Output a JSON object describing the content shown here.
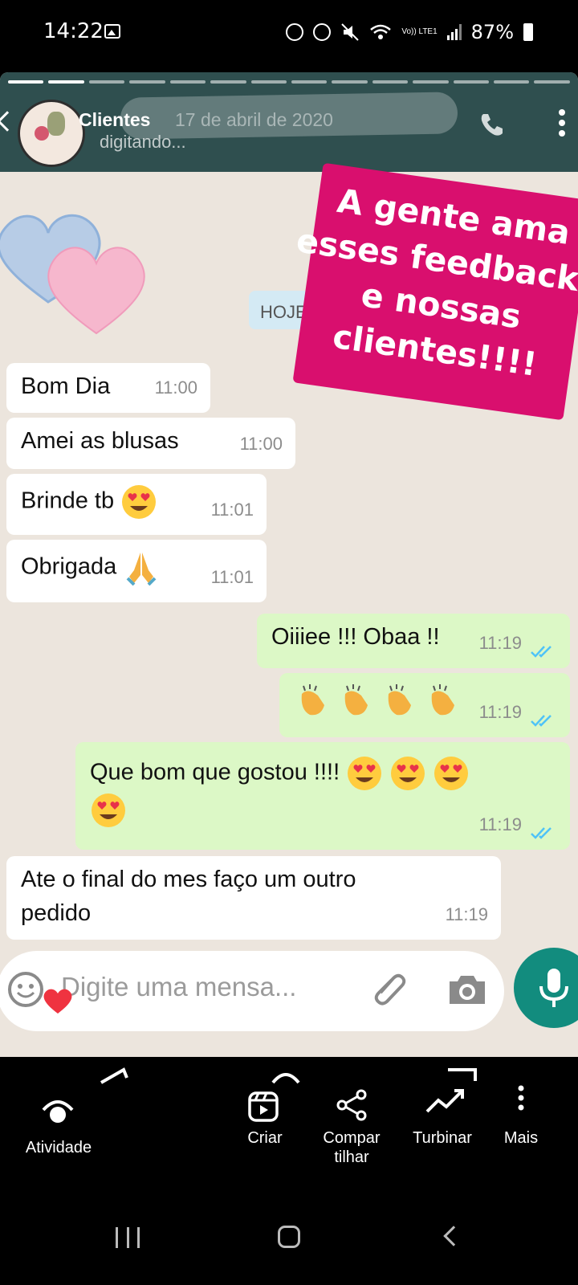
{
  "status_bar": {
    "time": "14:22",
    "network": "Vo)) LTE1",
    "battery": "87%"
  },
  "header": {
    "contact_name": "Clientes",
    "date": "17 de abril de 2020",
    "status": "digitando..."
  },
  "sticker": {
    "line1": "A gente ama",
    "line2": "esses feedbacks",
    "line3": "e nossas",
    "line4": "clientes!!!!",
    "color": "#d90f6e"
  },
  "date_chip": "HOJE",
  "messages": [
    {
      "direction": "in",
      "text": "Bom Dia",
      "time": "11:00"
    },
    {
      "direction": "in",
      "text": "Amei as blusas",
      "time": "11:00"
    },
    {
      "direction": "in",
      "text": "Brinde tb",
      "emoji": "heart-eyes",
      "time": "11:01"
    },
    {
      "direction": "in",
      "text": "Obrigada",
      "emoji": "folded-hands",
      "time": "11:01"
    },
    {
      "direction": "out",
      "text": "Oiiiee !!! Obaa !!",
      "time": "11:19",
      "read": true
    },
    {
      "direction": "out",
      "text": "",
      "emoji": "clapping-hands x4",
      "time": "11:19",
      "read": true
    },
    {
      "direction": "out",
      "text": "Que bom que gostou !!!!",
      "emoji": "heart-eyes x4",
      "time": "11:19",
      "read": true
    },
    {
      "direction": "in",
      "text": "Ate o final do mes faço um outro pedido",
      "time": "11:19"
    }
  ],
  "compose": {
    "placeholder": "Digite uma mensa..."
  },
  "actions": {
    "activity": "Atividade",
    "create": "Criar",
    "share_line1": "Compar",
    "share_line2": "tilhar",
    "boost": "Turbinar",
    "more": "Mais"
  },
  "colors": {
    "incoming_bubble": "#ffffff",
    "outgoing_bubble": "#dcf8c6",
    "header": "#2f4f4f",
    "read_ticks": "#4fc3f7",
    "mic_button": "#128c7e"
  }
}
